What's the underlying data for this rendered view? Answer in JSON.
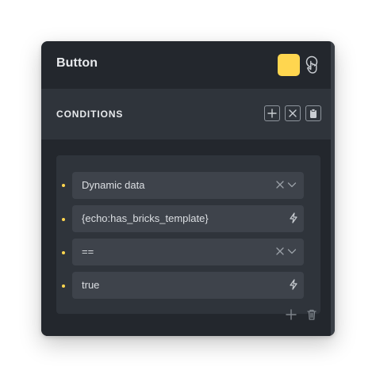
{
  "panel": {
    "title": "Button",
    "accent_color": "#ffd64f",
    "header_icons": [
      "color-swatch",
      "pointer-hand-icon"
    ]
  },
  "conditions": {
    "label": "CONDITIONS",
    "actions": [
      "add-icon",
      "close-icon",
      "clipboard-icon"
    ]
  },
  "condition_rows": [
    {
      "value": "Dynamic data",
      "control": "select",
      "icons": [
        "clear-icon",
        "chevron-down-icon"
      ]
    },
    {
      "value": "{echo:has_bricks_template}",
      "control": "input",
      "icons": [
        "dynamic-data-bolt-icon"
      ]
    },
    {
      "value": "==",
      "control": "select",
      "icons": [
        "clear-icon",
        "chevron-down-icon"
      ]
    },
    {
      "value": "true",
      "control": "input",
      "icons": [
        "dynamic-data-bolt-icon"
      ]
    }
  ],
  "group_actions": [
    "add-icon",
    "trash-icon"
  ]
}
